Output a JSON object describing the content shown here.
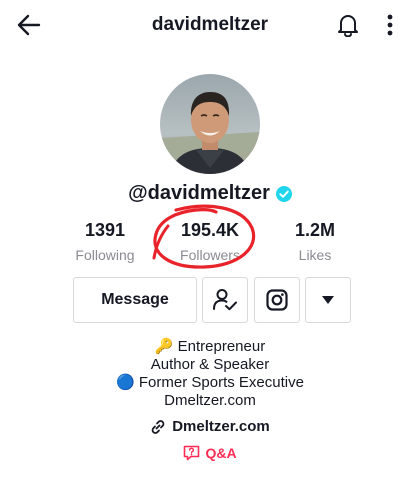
{
  "header": {
    "title": "davidmeltzer",
    "back_icon": "arrow-left-icon",
    "bell_icon": "bell-icon",
    "more_icon": "more-vertical-icon"
  },
  "profile": {
    "handle": "@davidmeltzer",
    "verified": true
  },
  "stats": [
    {
      "value": "1391",
      "label": "Following"
    },
    {
      "value": "195.4K",
      "label": "Followers"
    },
    {
      "value": "1.2M",
      "label": "Likes"
    }
  ],
  "actions": {
    "message_label": "Message",
    "following_icon": "person-check-icon",
    "instagram_icon": "instagram-icon",
    "dropdown_icon": "caret-down-icon"
  },
  "bio": {
    "lines": [
      "🔑 Entrepreneur",
      "Author & Speaker",
      "🔵 Former Sports Executive",
      "Dmeltzer.com"
    ]
  },
  "link": {
    "text": "Dmeltzer.com",
    "icon": "link-icon"
  },
  "qa": {
    "text": "Q&A",
    "icon": "qa-icon"
  },
  "colors": {
    "verified": "#20d5ec",
    "annotation_circle": "#e8232a",
    "qa_accent": "#fe2c55",
    "secondary_text": "#8a8b91"
  }
}
